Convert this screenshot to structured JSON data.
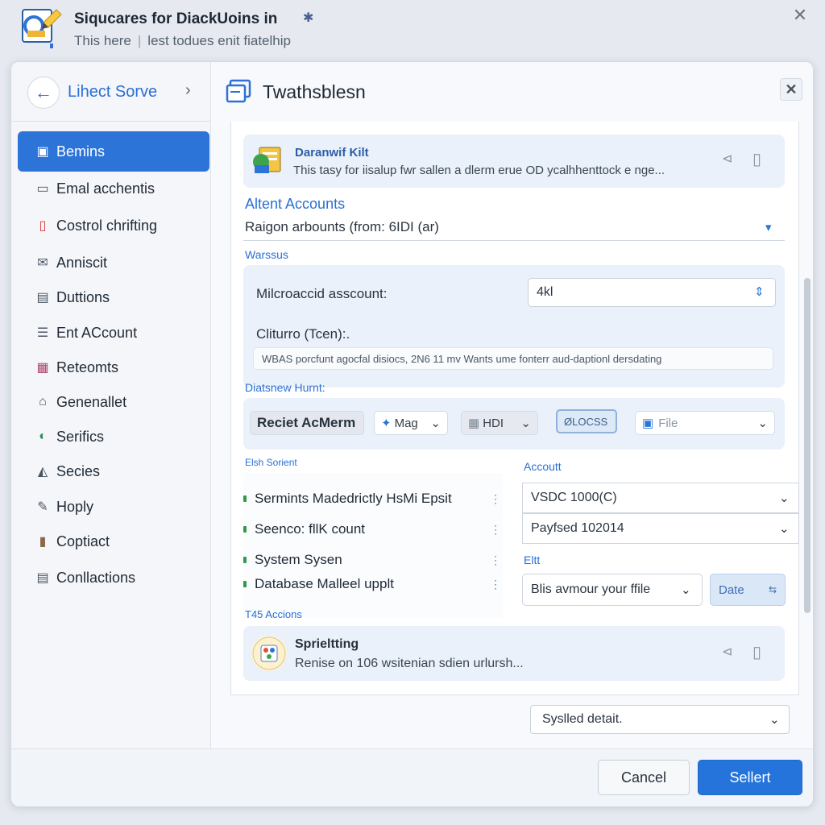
{
  "app": {
    "title": "Siqucares for DiackUoins in",
    "subtitle_left": "This here",
    "subtitle_sep": "|",
    "subtitle_right": "lest todues enit fiatelhip",
    "close_glyph": "✕"
  },
  "sidebar": {
    "back_label": "Lihect Sorve",
    "items": [
      {
        "label": "Bemins",
        "icon": "document-icon",
        "active": true
      },
      {
        "label": "Emal acchentis",
        "icon": "laptop-icon"
      },
      {
        "label": "Costrol chrifting",
        "icon": "file-icon"
      },
      {
        "label": "Anniscit",
        "icon": "mail-icon"
      },
      {
        "label": "Duttions",
        "icon": "card-icon"
      },
      {
        "label": "Ent ACcount",
        "icon": "list-icon"
      },
      {
        "label": "Reteomts",
        "icon": "report-icon"
      },
      {
        "label": "Genenallet",
        "icon": "home-icon"
      },
      {
        "label": "Serifics",
        "icon": "globe-icon"
      },
      {
        "label": "Secies",
        "icon": "chart-icon"
      },
      {
        "label": "Hoply",
        "icon": "edit-icon"
      },
      {
        "label": "Coptiact",
        "icon": "cup-icon"
      },
      {
        "label": "Conllactions",
        "icon": "stack-icon"
      }
    ]
  },
  "dialog": {
    "title": "Twathsblesn",
    "close_glyph": "✕"
  },
  "kit": {
    "title": "Daranwif Kilt",
    "description": "This tasy for iisalup fwr sallen a dlerm erue OD ycalhhenttock e nge..."
  },
  "accounts": {
    "heading": "Altent Accounts",
    "region_text": "Raigon arbounts (from: 6IDI (ar)",
    "section_label": "Warssus",
    "microaccid_label": "Milcroaccid asscount:",
    "microaccid_value": "4kl",
    "cliturro_label": "Cliturro (Tcen):.",
    "readonly_text": "WBAS porcfunt agocfal disiocs, 2N6 11 mv Wants ume fonterr aud-daptionl dersdating"
  },
  "tools": {
    "section_label": "Diatsnew Hurnt:",
    "reset_label": "Reciet AcMerm",
    "mag_label": "Mag",
    "hd_label": "HDI",
    "status_label": "ØLOCSS",
    "file_label": "File"
  },
  "list": {
    "section_label": "Elsh Sorient",
    "items": [
      "Sermints Madedrictly HsMi Epsit",
      "Seenco: fllK count",
      "System Sysen",
      "Database Malleel upplt"
    ],
    "footer_label": "T45 Accions"
  },
  "account": {
    "label": "Accoutt",
    "select1": "VSDC 1000(C)",
    "select2": "Payfsed 102014",
    "edit_label": "Eltt",
    "file_select": "Blis avmour your ffile",
    "date_label": "Date",
    "date_glyph": "⇆"
  },
  "spritting": {
    "title": "Sprieltting",
    "description": "Renise on 106 wsitenian sdien urlursh..."
  },
  "footer": {
    "select_label": "Syslled detait.",
    "cancel_label": "Cancel",
    "primary_label": "Sellert"
  },
  "colors": {
    "accent": "#2474dc",
    "sidebar_active": "#2c74d8",
    "link": "#2a6fd6"
  }
}
